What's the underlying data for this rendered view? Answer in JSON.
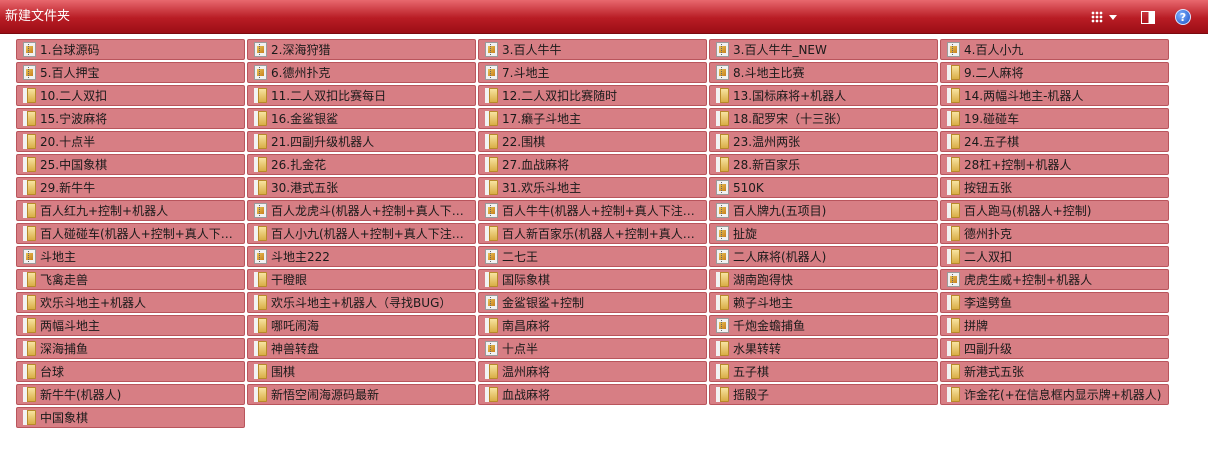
{
  "toolbar": {
    "new_folder_label": "新建文件夹",
    "view_icon": "grid-view-icon",
    "pane_icon": "preview-pane-icon",
    "help_icon": "help-icon",
    "help_glyph": "?"
  },
  "colors": {
    "toolbar_red": "#b81c24",
    "item_fill": "#d77e84",
    "item_border": "#b9555c"
  },
  "files": [
    {
      "name": "1.台球源码",
      "type": "zip"
    },
    {
      "name": "2.深海狩猎",
      "type": "zip"
    },
    {
      "name": "3.百人牛牛",
      "type": "zip"
    },
    {
      "name": "3.百人牛牛_NEW",
      "type": "zip"
    },
    {
      "name": "4.百人小九",
      "type": "zip"
    },
    {
      "name": "5.百人押宝",
      "type": "zip"
    },
    {
      "name": "6.德州扑克",
      "type": "zip"
    },
    {
      "name": "7.斗地主",
      "type": "zip"
    },
    {
      "name": "8.斗地主比赛",
      "type": "zip"
    },
    {
      "name": "9.二人麻将",
      "type": "folder"
    },
    {
      "name": "10.二人双扣",
      "type": "folder"
    },
    {
      "name": "11.二人双扣比赛每日",
      "type": "folder"
    },
    {
      "name": "12.二人双扣比赛随时",
      "type": "folder"
    },
    {
      "name": "13.国标麻将+机器人",
      "type": "folder"
    },
    {
      "name": "14.两幅斗地主-机器人",
      "type": "folder"
    },
    {
      "name": "15.宁波麻将",
      "type": "folder"
    },
    {
      "name": "16.金鲨银鲨",
      "type": "folder"
    },
    {
      "name": "17.癞子斗地主",
      "type": "folder"
    },
    {
      "name": "18.配罗宋（十三张）",
      "type": "folder"
    },
    {
      "name": "19.碰碰车",
      "type": "folder"
    },
    {
      "name": "20.十点半",
      "type": "folder"
    },
    {
      "name": "21.四副升级机器人",
      "type": "folder"
    },
    {
      "name": "22.围棋",
      "type": "folder"
    },
    {
      "name": "23.温州两张",
      "type": "folder"
    },
    {
      "name": "24.五子棋",
      "type": "folder"
    },
    {
      "name": "25.中国象棋",
      "type": "folder"
    },
    {
      "name": "26.扎金花",
      "type": "folder"
    },
    {
      "name": "27.血战麻将",
      "type": "folder"
    },
    {
      "name": "28.新百家乐",
      "type": "folder"
    },
    {
      "name": "28杠+控制+机器人",
      "type": "folder"
    },
    {
      "name": "29.新牛牛",
      "type": "folder"
    },
    {
      "name": "30.港式五张",
      "type": "folder"
    },
    {
      "name": "31.欢乐斗地主",
      "type": "folder"
    },
    {
      "name": "510K",
      "type": "zip"
    },
    {
      "name": "按钮五张",
      "type": "folder"
    },
    {
      "name": "百人红九+控制+机器人",
      "type": "folder"
    },
    {
      "name": "百人龙虎斗(机器人+控制+真人下注显示)",
      "type": "zip"
    },
    {
      "name": "百人牛牛(机器人+控制+真人下注显示)",
      "type": "zip"
    },
    {
      "name": "百人牌九(五项目)",
      "type": "zip"
    },
    {
      "name": "百人跑马(机器人+控制)",
      "type": "folder"
    },
    {
      "name": "百人碰碰车(机器人+控制+真人下注显示)",
      "type": "folder"
    },
    {
      "name": "百人小九(机器人+控制+真人下注显示)",
      "type": "folder"
    },
    {
      "name": "百人新百家乐(机器人+控制+真人下注显示)",
      "type": "folder"
    },
    {
      "name": "扯旋",
      "type": "zip"
    },
    {
      "name": "德州扑克",
      "type": "folder"
    },
    {
      "name": "斗地主",
      "type": "zip"
    },
    {
      "name": "斗地主222",
      "type": "zip"
    },
    {
      "name": "二七王",
      "type": "zip"
    },
    {
      "name": "二人麻将(机器人)",
      "type": "zip"
    },
    {
      "name": "二人双扣",
      "type": "folder"
    },
    {
      "name": "飞禽走兽",
      "type": "folder"
    },
    {
      "name": "干瞪眼",
      "type": "folder"
    },
    {
      "name": "国际象棋",
      "type": "folder"
    },
    {
      "name": "湖南跑得快",
      "type": "folder"
    },
    {
      "name": "虎虎生威+控制+机器人",
      "type": "zip"
    },
    {
      "name": "欢乐斗地主+机器人",
      "type": "folder"
    },
    {
      "name": "欢乐斗地主+机器人（寻找BUG）",
      "type": "folder"
    },
    {
      "name": "金鲨银鲨+控制",
      "type": "zip"
    },
    {
      "name": "赖子斗地主",
      "type": "folder"
    },
    {
      "name": "李逵劈鱼",
      "type": "folder"
    },
    {
      "name": "两幅斗地主",
      "type": "folder"
    },
    {
      "name": "哪吒闹海",
      "type": "folder"
    },
    {
      "name": "南昌麻将",
      "type": "folder"
    },
    {
      "name": "千炮金蟾捕鱼",
      "type": "zip"
    },
    {
      "name": "拼牌",
      "type": "folder"
    },
    {
      "name": "深海捕鱼",
      "type": "folder"
    },
    {
      "name": "神兽转盘",
      "type": "folder"
    },
    {
      "name": "十点半",
      "type": "zip"
    },
    {
      "name": "水果转转",
      "type": "folder"
    },
    {
      "name": "四副升级",
      "type": "folder"
    },
    {
      "name": "台球",
      "type": "folder"
    },
    {
      "name": "围棋",
      "type": "folder"
    },
    {
      "name": "温州麻将",
      "type": "folder"
    },
    {
      "name": "五子棋",
      "type": "folder"
    },
    {
      "name": "新港式五张",
      "type": "folder"
    },
    {
      "name": "新牛牛(机器人)",
      "type": "folder"
    },
    {
      "name": "新悟空闹海源码最新",
      "type": "folder"
    },
    {
      "name": "血战麻将",
      "type": "folder"
    },
    {
      "name": "摇骰子",
      "type": "folder"
    },
    {
      "name": "诈金花(+在信息框内显示牌+机器人)",
      "type": "folder"
    },
    {
      "name": "中国象棋",
      "type": "folder"
    }
  ]
}
